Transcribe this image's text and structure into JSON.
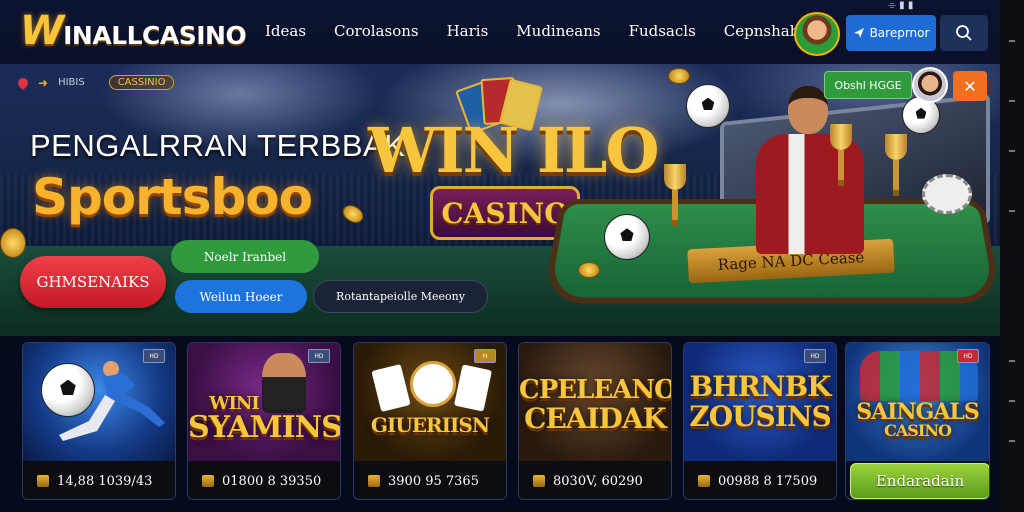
{
  "brand": {
    "logo_initial": "W",
    "logo_rest": "INALLCASINO"
  },
  "nav": [
    "Ideas",
    "Corolasons",
    "Haris",
    "Mudineans",
    "Fudsacls",
    "Cepnshaboy"
  ],
  "header": {
    "primary_button": "Bareprnor",
    "status_text": "⌯ ▮ ▮"
  },
  "breadcrumb": {
    "item": "HIBIS",
    "tag": "CASSINIO"
  },
  "hero": {
    "title": "PENGALRRAN TERBBAK",
    "subtitle": "Sportsboo",
    "center_logo": "WIN ILO",
    "center_plaque": "CASINO",
    "table_sign": "Rage NA DC Cease",
    "promo_badge": "Obshl HGGE",
    "close": "✕"
  },
  "chips": [
    {
      "label": "GHMSENAIKS",
      "color": "#d9262f"
    },
    {
      "label": "Noelr Iranbel",
      "color": "#2f9b3c"
    },
    {
      "label": "Weilun Hoeer",
      "color": "#1f73dc"
    },
    {
      "label": "Rotantapeiolle Meeony",
      "color": "#1b2336"
    }
  ],
  "games": [
    {
      "title": "",
      "footer": "14,88 1039/43",
      "theme": "soccer"
    },
    {
      "title": "SYAMINS",
      "title_top": "WINI",
      "footer": "01800 8 39350",
      "theme": "slots"
    },
    {
      "title": "GIUERIISN",
      "footer": "3900 95 7365",
      "theme": "cards"
    },
    {
      "title": "CEAIDAK",
      "title_top": "CPELEANO",
      "footer": "8030V, 60290",
      "theme": "gold"
    },
    {
      "title": "ZOUSINS",
      "title_top": "BHRNBK",
      "footer": "00988 8 17509",
      "theme": "blue"
    },
    {
      "title": "SAINGALS",
      "title_bottom": "CASINO",
      "cta": "Endaradain",
      "theme": "team"
    }
  ],
  "icons": {
    "search": "search-icon",
    "send": "send-icon",
    "home": "home-icon",
    "close": "close-icon"
  }
}
